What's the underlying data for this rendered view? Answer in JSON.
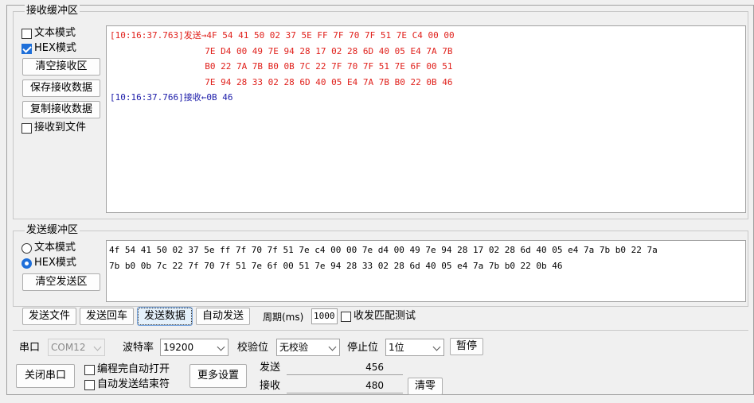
{
  "recv_group": {
    "title": "接收缓冲区",
    "text_mode": "文本模式",
    "hex_mode": "HEX模式",
    "clear_btn": "清空接收区",
    "save_btn": "保存接收数据",
    "copy_btn": "复制接收数据",
    "to_file": "接收到文件",
    "lines": [
      {
        "color": "red",
        "text": "[10:16:37.763]发送→4F 54 41 50 02 37 5E FF 7F 70 7F 51 7E C4 00 00"
      },
      {
        "color": "red",
        "text": "                  7E D4 00 49 7E 94 28 17 02 28 6D 40 05 E4 7A 7B"
      },
      {
        "color": "red",
        "text": "                  B0 22 7A 7B B0 0B 7C 22 7F 70 7F 51 7E 6F 00 51"
      },
      {
        "color": "red",
        "text": "                  7E 94 28 33 02 28 6D 40 05 E4 7A 7B B0 22 0B 46"
      },
      {
        "color": "blue",
        "text": "[10:16:37.766]接收←0B 46"
      }
    ]
  },
  "send_group": {
    "title": "发送缓冲区",
    "text_mode": "文本模式",
    "hex_mode": "HEX模式",
    "clear_btn": "清空发送区",
    "content_line1": "4f 54 41 50 02 37 5e ff 7f 70 7f 51 7e c4 00 00 7e d4 00 49 7e 94 28 17 02 28 6d 40 05 e4 7a 7b b0 22 7a",
    "content_line2": "7b b0 0b 7c 22 7f 70 7f 51 7e 6f 00 51 7e 94 28 33 02 28 6d 40 05 e4 7a 7b b0 22 0b 46"
  },
  "send_bar": {
    "send_file": "发送文件",
    "send_enter": "发送回车",
    "send_data": "发送数据",
    "auto_send": "自动发送",
    "period_label": "周期(ms)",
    "period_value": "1000",
    "match_test": "收发匹配测试"
  },
  "serial": {
    "port_label": "串口",
    "port_value": "COM12",
    "baud_label": "波特率",
    "baud_value": "19200",
    "parity_label": "校验位",
    "parity_value": "无校验",
    "stop_label": "停止位",
    "stop_value": "1位",
    "pause_btn": "暂停",
    "close_btn": "关闭串口",
    "auto_open": "编程完自动打开",
    "auto_end": "自动发送结束符",
    "more_btn": "更多设置",
    "send_label": "发送",
    "send_count": "456",
    "recv_label": "接收",
    "recv_count": "480",
    "clear_btn": "清零"
  }
}
